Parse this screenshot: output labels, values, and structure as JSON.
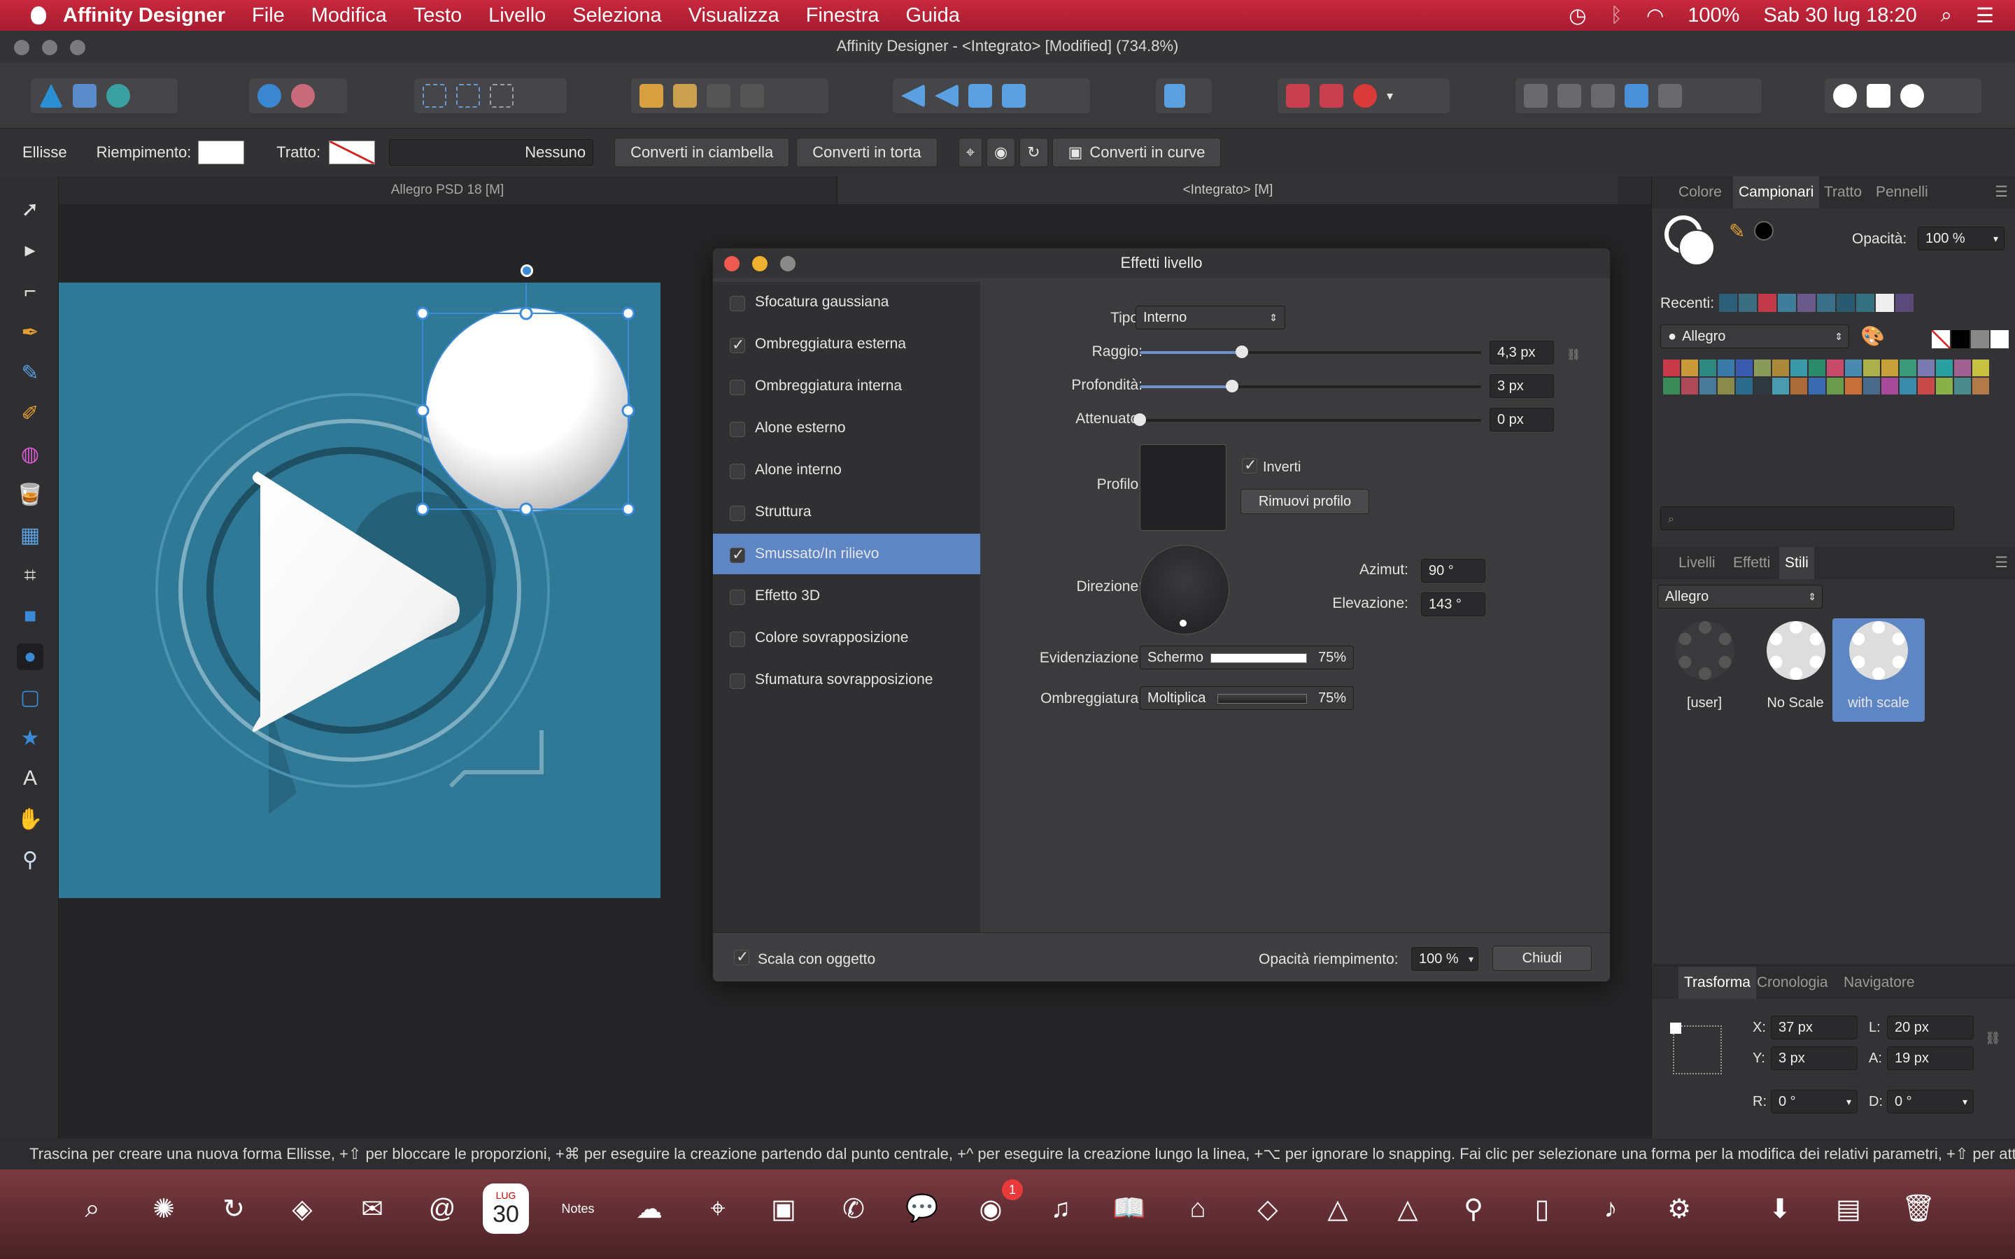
{
  "menubar": {
    "app_name": "Affinity Designer",
    "items": [
      "File",
      "Modifica",
      "Testo",
      "Livello",
      "Seleziona",
      "Visualizza",
      "Finestra",
      "Guida"
    ],
    "battery": "100%",
    "datetime": "Sab 30 lug  18:20"
  },
  "window": {
    "title": "Affinity Designer - <Integrato> [Modified] (734.8%)"
  },
  "context_bar": {
    "tool_name": "Ellisse",
    "fill_label": "Riempimento:",
    "stroke_label": "Tratto:",
    "stroke_value": "Nessuno",
    "donut_button": "Converti in ciambella",
    "pie_button": "Converti in torta",
    "curves_button": "Converti in curve"
  },
  "doc_tabs": [
    "Allegro PSD 18 [M]",
    "<Integrato> [M]"
  ],
  "dialog": {
    "title": "Effetti livello",
    "effects": [
      {
        "label": "Sfocatura gaussiana",
        "checked": false
      },
      {
        "label": "Ombreggiatura esterna",
        "checked": true
      },
      {
        "label": "Ombreggiatura interna",
        "checked": false
      },
      {
        "label": "Alone esterno",
        "checked": false
      },
      {
        "label": "Alone interno",
        "checked": false
      },
      {
        "label": "Struttura",
        "checked": false
      },
      {
        "label": "Smussato/In rilievo",
        "checked": true,
        "selected": true
      },
      {
        "label": "Effetto 3D",
        "checked": false
      },
      {
        "label": "Colore sovrapposizione",
        "checked": false
      },
      {
        "label": "Sfumatura sovrapposizione",
        "checked": false
      }
    ],
    "tipo_label": "Tipo:",
    "tipo_value": "Interno",
    "raggio_label": "Raggio:",
    "raggio_value": "4,3 px",
    "raggio_level": 0.3,
    "profondita_label": "Profondità:",
    "profondita_value": "3 px",
    "profondita_level": 0.27,
    "attenuato_label": "Attenuato:",
    "attenuato_value": "0 px",
    "attenuato_level": 0,
    "profilo_label": "Profilo:",
    "inverti_label": "Inverti",
    "rimuovi_label": "Rimuovi profilo",
    "direzione_label": "Direzione:",
    "azimut_label": "Azimut:",
    "azimut_value": "90 °",
    "elevazione_label": "Elevazione:",
    "elevazione_value": "143 °",
    "evidenziazione_label": "Evidenziazione:",
    "evidenziazione_mode": "Schermo",
    "evidenziazione_pct": "75%",
    "ombreggiatura_label": "Ombreggiatura:",
    "ombreggiatura_mode": "Moltiplica",
    "ombreggiatura_pct": "75%",
    "scale_label": "Scala con oggetto",
    "fill_opacity_label": "Opacità riempimento:",
    "fill_opacity_value": "100 %",
    "close_button": "Chiudi"
  },
  "swatch_panel": {
    "tabs": [
      "Colore",
      "Campionari",
      "Tratto",
      "Pennelli"
    ],
    "opacity_label": "Opacità:",
    "opacity_value": "100 %",
    "recent_label": "Recenti:",
    "palette_name": "Allegro",
    "recent_colors": [
      "#2e5f78",
      "#3b6d80",
      "#c23a4a",
      "#3f7e9a",
      "#6a5a8a",
      "#3a6f8a",
      "#2a5a70",
      "#337080",
      "#eeeeee",
      "#5a4a7a"
    ],
    "palette_colors": [
      "#c83a48",
      "#c89a3a",
      "#2e8a80",
      "#3a7aa8",
      "#3a5ab0",
      "#8a9a5a",
      "#aa8a3a",
      "#3a9aaa",
      "#2a8a6a",
      "#c84a6a",
      "#4a8ab0",
      "#aab04a",
      "#c8a03a",
      "#3a9a7a",
      "#7a7ab0",
      "#2aa0a0",
      "#a06090",
      "#c8c040",
      "#3a8a5a",
      "#b04a5a",
      "#4a7a9a",
      "#8a8a4a",
      "#2a6a8a",
      "#303840",
      "#4a9ab0",
      "#aa6a3a",
      "#3a6ab0",
      "#6a9a4a",
      "#c8703a",
      "#4a6a8a",
      "#a84a9a",
      "#3a8aaa",
      "#c84a4a",
      "#8ab04a",
      "#4a8a8a",
      "#b07a4a"
    ]
  },
  "styles_panel": {
    "tabs": [
      "Livelli",
      "Effetti",
      "Stili"
    ],
    "category": "Allegro",
    "styles": [
      "[user]",
      "No Scale",
      "with scale"
    ]
  },
  "transform_panel": {
    "tabs": [
      "Trasforma",
      "Cronologia",
      "Navigatore"
    ],
    "x_label": "X:",
    "x_value": "37 px",
    "y_label": "Y:",
    "y_value": "3 px",
    "l_label": "L:",
    "l_value": "20 px",
    "a_label": "A:",
    "a_value": "19 px",
    "r_label": "R:",
    "r_value": "0 °",
    "d_label": "D:",
    "d_value": "0 °"
  },
  "status_bar": {
    "text": "Trascina per creare una nuova forma Ellisse, +⇧ per bloccare le proporzioni, +⌘ per eseguire la creazione partendo dal punto centrale, +^ per eseguire la creazione lungo la linea, +⌥ per ignorare lo snapping. Fai clic per selezionare una forma per la modifica dei relativi parametri, +⇧ per atti"
  },
  "dock": {
    "calendar_month": "LUG",
    "calendar_day": "30",
    "notes_label": "Notes",
    "badge": "1"
  }
}
